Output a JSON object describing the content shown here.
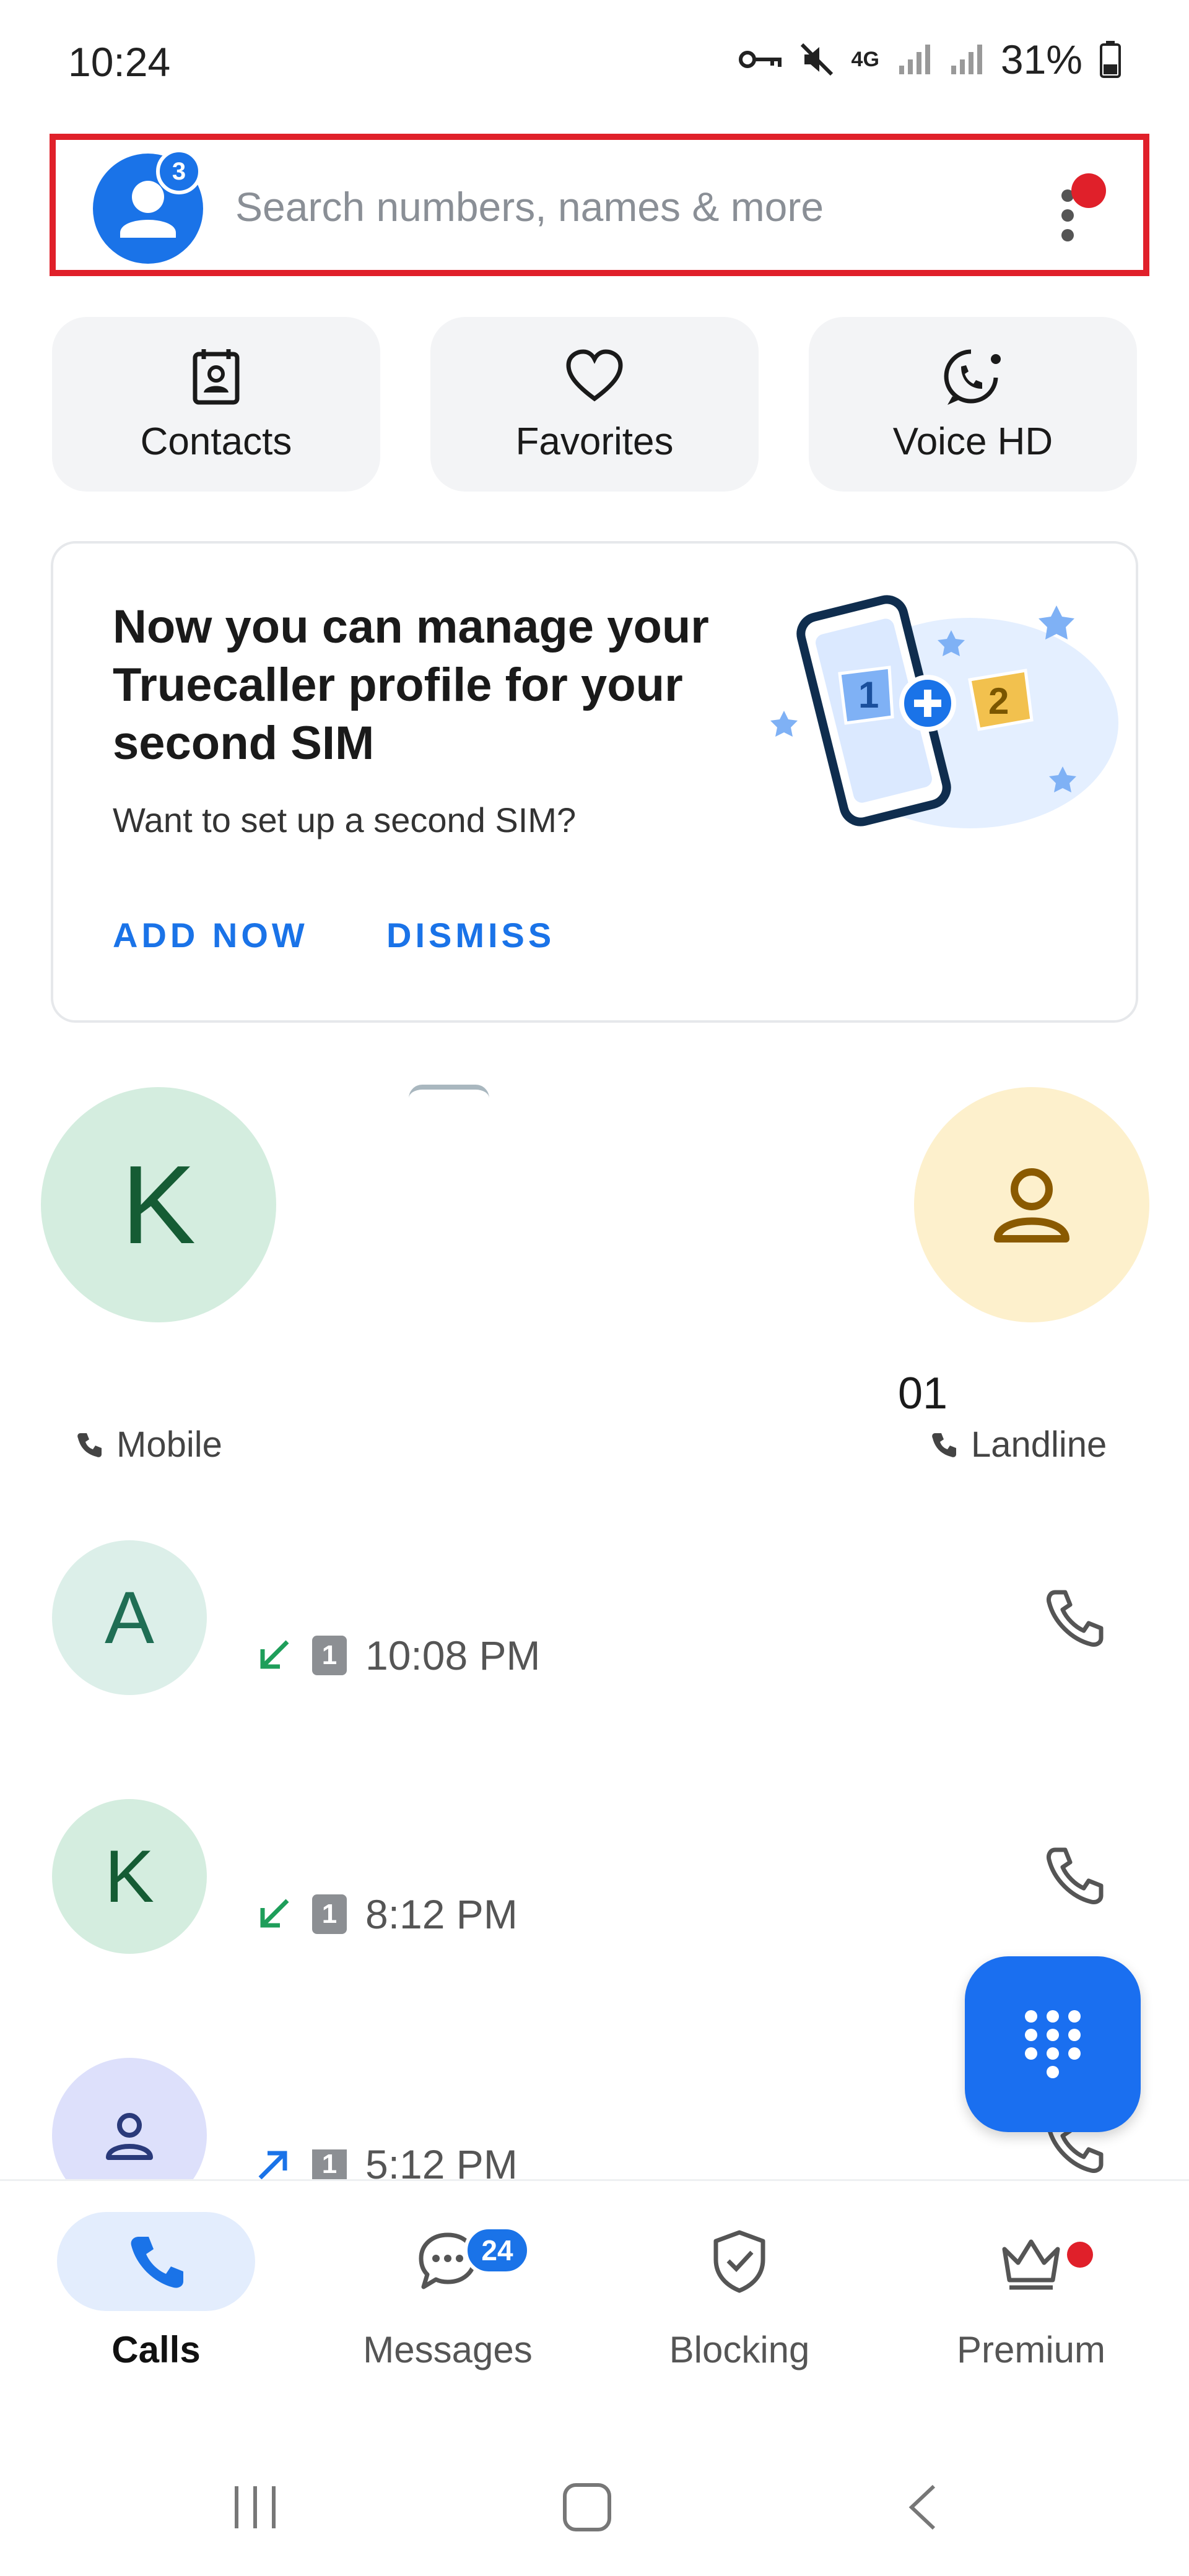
{
  "status_bar": {
    "time": "10:24",
    "battery": "31%",
    "network": "4G"
  },
  "search": {
    "placeholder": "Search numbers, names & more",
    "profile_badge": "3"
  },
  "quick_actions": [
    {
      "label": "Contacts",
      "icon": "contacts-icon"
    },
    {
      "label": "Favorites",
      "icon": "heart-icon"
    },
    {
      "label": "Voice HD",
      "icon": "voice-hd-icon"
    }
  ],
  "promo_card": {
    "title": "Now you can manage your Truecaller profile for your second SIM",
    "subtitle": "Want to set up a second SIM?",
    "primary_button": "ADD NOW",
    "secondary_button": "DISMISS",
    "illustration": "dual-sim-phone-illustration"
  },
  "frequent_contacts": [
    {
      "initial": "K",
      "name": "",
      "type": "Mobile"
    },
    {
      "initial": "",
      "name": "01",
      "type": "Landline"
    }
  ],
  "call_log": [
    {
      "initial": "A",
      "direction": "incoming",
      "sim": "1",
      "time": "10:08 PM"
    },
    {
      "initial": "K",
      "direction": "incoming",
      "sim": "1",
      "time": "8:12 PM"
    },
    {
      "initial": "",
      "direction": "outgoing",
      "sim": "1",
      "time": "5:12 PM"
    }
  ],
  "bottom_nav": [
    {
      "label": "Calls",
      "active": true
    },
    {
      "label": "Messages",
      "badge": "24"
    },
    {
      "label": "Blocking"
    },
    {
      "label": "Premium",
      "dot": true
    }
  ],
  "colors": {
    "accent": "#1a73e8",
    "highlight_border": "#e0202a",
    "chip_bg": "#f3f4f6"
  }
}
